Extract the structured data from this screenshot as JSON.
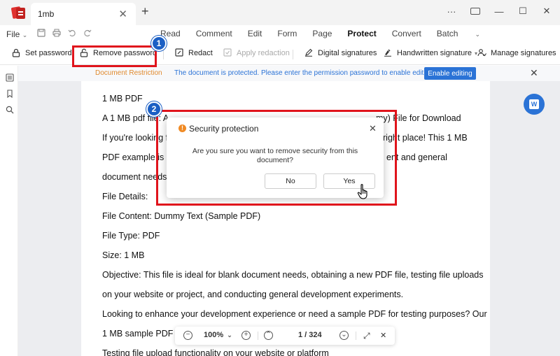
{
  "tab": {
    "title": "1mb",
    "close": "✕",
    "new": "+"
  },
  "window": {
    "more": "···",
    "minimize": "—",
    "maximize": "☐",
    "close": "✕"
  },
  "menubar": {
    "file": "File",
    "file_caret": "⌄",
    "items": [
      "Read",
      "Comment",
      "Edit",
      "Form",
      "Page",
      "Protect",
      "Convert",
      "Batch"
    ],
    "active": "Protect",
    "batch_caret": "⌄"
  },
  "toolbar": {
    "set_password": "Set password",
    "remove_password": "Remove password",
    "redact": "Redact",
    "apply_redaction": "Apply redaction",
    "digital_signatures": "Digital signatures",
    "handwritten_signature": "Handwritten signature",
    "manage_signatures": "Manage signatures",
    "more": "›"
  },
  "notice": {
    "label": "Document Restriction",
    "message": "The document is protected. Please enter the permission password to enable editing",
    "button": "Enable editing",
    "close": "✕"
  },
  "document": {
    "lines": [
      "1 MB PDF",
      "A 1 MB pdf file: A",
      "If you're looking f",
      "PDF example is p",
      "document needs.",
      "File Details:",
      "File Content: Dummy Text (Sample PDF)",
      "File Type: PDF",
      "Size: 1 MB",
      "Objective: This file is ideal for blank document needs, obtaining a new PDF file, testing file uploads",
      "on your website or project, and conducting general development experiments.",
      "Looking to enhance your development experience or need a sample PDF for testing purposes? Our",
      "1 MB sample PDF fi",
      "Testing file upload functionality on your website or platform"
    ],
    "right_fragments": [
      "my) File for Download",
      "right place! This 1 MB",
      "ent and general"
    ]
  },
  "dialog": {
    "title": "Security protection",
    "warn_glyph": "!",
    "close": "✕",
    "message": "Are you sure you want to remove security from this document?",
    "no": "No",
    "yes": "Yes"
  },
  "navbar": {
    "zoom": "100%",
    "zoom_caret": "⌄",
    "page": "1 / 324",
    "zoom_out": "−",
    "zoom_in": "+",
    "prev": "⌃",
    "next": "⌄",
    "fullscreen": "⤢",
    "close": "✕"
  },
  "callouts": {
    "one": "1",
    "two": "2"
  },
  "word_fab": "W",
  "colors": {
    "accent": "#2b73d6",
    "highlight": "#e0141c",
    "badge": "#1b5fc4",
    "warning": "#f08a24"
  }
}
